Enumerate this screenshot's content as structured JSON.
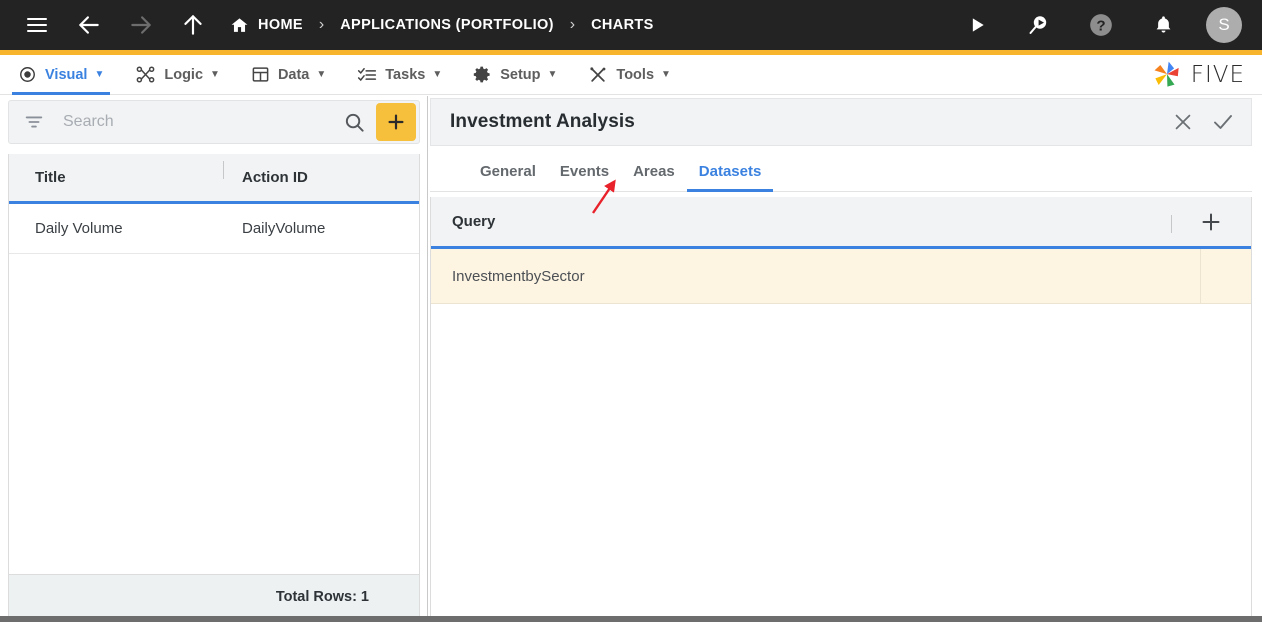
{
  "topbar": {
    "icons": [
      {
        "name": "hamburger-menu-icon",
        "label": "Menu"
      },
      {
        "name": "back-arrow-icon",
        "label": "Back"
      },
      {
        "name": "forward-arrow-icon",
        "label": "Forward"
      },
      {
        "name": "up-arrow-icon",
        "label": "Up"
      }
    ],
    "breadcrumb": [
      {
        "label": "HOME",
        "icon": "home-icon"
      },
      {
        "label": "APPLICATIONS (PORTFOLIO)"
      },
      {
        "label": "CHARTS"
      }
    ],
    "separator": "›",
    "right_icons": [
      {
        "name": "run-play-icon"
      },
      {
        "name": "search-debug-icon"
      },
      {
        "name": "help-question-icon"
      },
      {
        "name": "notifications-bell-icon"
      }
    ],
    "avatar_initial": "S",
    "accent_color": "#f6b52d",
    "background_color": "#232323"
  },
  "menubar": {
    "items": [
      {
        "label": "Visual",
        "icon": "eye-icon",
        "caret": "▼",
        "active": true
      },
      {
        "label": "Logic",
        "icon": "logic-nodes-icon",
        "caret": "▼",
        "active": false
      },
      {
        "label": "Data",
        "icon": "table-grid-icon",
        "caret": "▼",
        "active": false
      },
      {
        "label": "Tasks",
        "icon": "checklist-icon",
        "caret": "▼",
        "active": false
      },
      {
        "label": "Setup",
        "icon": "gear-icon",
        "caret": "▼",
        "active": false
      },
      {
        "label": "Tools",
        "icon": "wrench-screwdriver-icon",
        "caret": "▼",
        "active": false
      }
    ],
    "brand": "FIVE",
    "active_color": "#3b82e0"
  },
  "left_panel": {
    "search": {
      "placeholder": "Search",
      "value": "",
      "filter_icon": "filter-icon",
      "search_icon": "magnifier-icon",
      "add_button_label": "+",
      "add_button_color": "#f6bf3c"
    },
    "table": {
      "columns": [
        "Title",
        "Action ID"
      ],
      "rows": [
        {
          "title": "Daily Volume",
          "action_id": "DailyVolume"
        }
      ]
    },
    "total_rows_label": "Total Rows: 1"
  },
  "right_panel": {
    "title": "Investment Analysis",
    "actions": [
      {
        "name": "close-icon",
        "label": "✕"
      },
      {
        "name": "confirm-check-icon",
        "label": "✓"
      }
    ],
    "tabs": [
      {
        "label": "General",
        "active": false
      },
      {
        "label": "Events",
        "active": false
      },
      {
        "label": "Areas",
        "active": false
      },
      {
        "label": "Datasets",
        "active": true
      }
    ],
    "query_table": {
      "column_header": "Query",
      "add_button_label": "+",
      "rows": [
        {
          "query": "InvestmentbySector",
          "selected": true
        }
      ],
      "selected_row_color": "#fdf5e2"
    }
  },
  "annotation": {
    "arrow_color": "#e8212a",
    "points_to": "Areas"
  }
}
